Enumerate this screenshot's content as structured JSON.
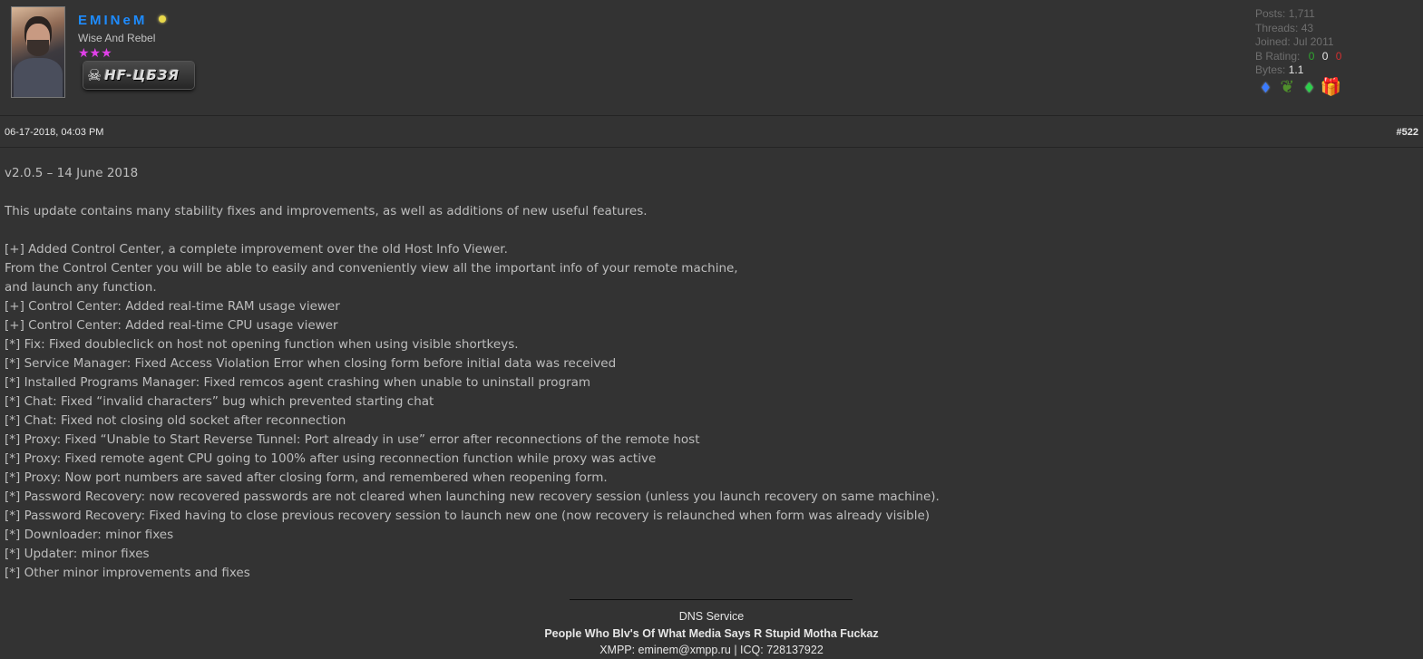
{
  "user": {
    "name": "EMINeM",
    "title": "Wise And Rebel",
    "stars": "★★★",
    "group_badge": "НF-ЦБЗЯ",
    "skull": "☠"
  },
  "stats": {
    "posts_label": "Posts:",
    "posts_value": "1,711",
    "threads_label": "Threads:",
    "threads_value": "43",
    "joined_label": "Joined:",
    "joined_value": "Jul 2011",
    "rating_label": "B Rating:",
    "rating_positive": "0",
    "rating_neutral": "0",
    "rating_negative": "0",
    "bytes_label": "Bytes:",
    "bytes_value": "1.1"
  },
  "awards": [
    {
      "icon": "blue-diamond-icon",
      "glyph": "♦"
    },
    {
      "icon": "leaf-icon",
      "glyph": "❦"
    },
    {
      "icon": "green-gem-icon",
      "glyph": "♦"
    },
    {
      "icon": "gift-icon",
      "glyph": "🎁"
    }
  ],
  "post": {
    "date": "06-17-2018, 04:03 PM",
    "number": "#522",
    "lines": [
      "v2.0.5 – 14 June 2018",
      "",
      "This update contains many stability fixes and improvements, as well as additions of new useful features.",
      "",
      "[+] Added Control Center, a complete improvement over the old Host Info Viewer.",
      "From the Control Center you will be able to easily and conveniently view all the important info of your remote machine,",
      "and launch any function.",
      "[+] Control Center: Added real-time RAM usage viewer",
      "[+] Control Center: Added real-time CPU usage viewer",
      "[*] Fix: Fixed doubleclick on host not opening function when using visible shortkeys.",
      "[*] Service Manager: Fixed Access Violation Error when closing form before initial data was received",
      "[*] Installed Programs Manager: Fixed remcos agent crashing when unable to uninstall program",
      "[*] Chat: Fixed “invalid characters” bug which prevented starting chat",
      "[*] Chat: Fixed not closing old socket after reconnection",
      "[*] Proxy: Fixed “Unable to Start Reverse Tunnel: Port already in use” error after reconnections of the remote host",
      "[*] Proxy: Fixed remote agent CPU going to 100% after using reconnection function while proxy was active",
      "[*] Proxy: Now port numbers are saved after closing form, and remembered when reopening form.",
      "[*] Password Recovery: now recovered passwords are not cleared when launching new recovery session (unless you launch recovery on same machine).",
      "[*] Password Recovery: Fixed having to close previous recovery session to launch new one (now recovery is relaunched when form was already visible)",
      "[*] Downloader: minor fixes",
      "[*] Updater: minor fixes",
      "[*] Other minor improvements and fixes"
    ]
  },
  "signature": {
    "line1": "DNS Service",
    "line2": "People Who Blv's Of What Media Says R Stupid Motha Fuckaz",
    "line3": "XMPP: eminem@xmpp.ru | ICQ: 728137922"
  },
  "colors": {
    "background": "#333333",
    "username": "#1e8cff",
    "stars": "#e040e8",
    "rating_positive": "#2fa52f",
    "rating_negative": "#d03030"
  }
}
